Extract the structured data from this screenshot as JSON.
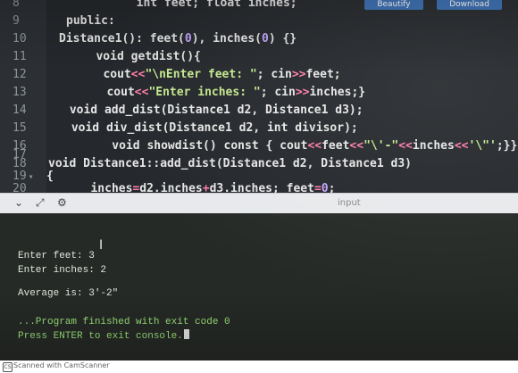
{
  "editor": {
    "top_buttons": [
      "Beautify",
      "Download"
    ],
    "lines": [
      {
        "num": "8",
        "segments": [
          {
            "t": "        int feet; float inches;",
            "c": "kw"
          }
        ]
      },
      {
        "num": "9",
        "segments": [
          {
            "t": "public:",
            "c": "kw"
          }
        ]
      },
      {
        "num": "10",
        "segments": [
          {
            "t": "Distance1(): feet(",
            "c": "kw"
          },
          {
            "t": "0",
            "c": "num"
          },
          {
            "t": "), inches(",
            "c": "kw"
          },
          {
            "t": "0",
            "c": "num"
          },
          {
            "t": ") {}",
            "c": "kw"
          }
        ]
      },
      {
        "num": "11",
        "segments": [
          {
            "t": "   void getdist(){",
            "c": "kw"
          }
        ]
      },
      {
        "num": "12",
        "segments": [
          {
            "t": "   cout",
            "c": "kw"
          },
          {
            "t": "<<",
            "c": "op"
          },
          {
            "t": "\"\\nEnter feet: \"",
            "c": "str"
          },
          {
            "t": "; cin",
            "c": "kw"
          },
          {
            "t": ">>",
            "c": "op"
          },
          {
            "t": "feet;",
            "c": "kw"
          }
        ]
      },
      {
        "num": "13",
        "segments": [
          {
            "t": "   cout",
            "c": "kw"
          },
          {
            "t": "<<",
            "c": "op"
          },
          {
            "t": "\"Enter inches: \"",
            "c": "str"
          },
          {
            "t": "; cin",
            "c": "kw"
          },
          {
            "t": ">>",
            "c": "op"
          },
          {
            "t": "inches;}",
            "c": "kw"
          }
        ]
      },
      {
        "num": "14",
        "segments": [
          {
            "t": " void add_dist(Distance1 d2, Distance1 d3);",
            "c": "kw"
          }
        ]
      },
      {
        "num": "15",
        "segments": [
          {
            "t": " void div_dist(Distance1 d2, int divisor);",
            "c": "kw"
          }
        ]
      },
      {
        "num": "16",
        "segments": [
          {
            "t": "    void showdist() const { cout",
            "c": "kw"
          },
          {
            "t": "<<",
            "c": "op"
          },
          {
            "t": "feet",
            "c": "kw"
          },
          {
            "t": "<<",
            "c": "op"
          },
          {
            "t": "\"\\'-\"",
            "c": "str"
          },
          {
            "t": "<<",
            "c": "op"
          },
          {
            "t": "inches",
            "c": "kw"
          },
          {
            "t": "<<",
            "c": "op"
          },
          {
            "t": "'\\\"'",
            "c": "str"
          },
          {
            "t": ";}};",
            "c": "kw"
          }
        ]
      },
      {
        "num": "17",
        "segments": [
          {
            "t": "",
            "c": "kw"
          }
        ]
      },
      {
        "num": "18",
        "segments": [
          {
            "t": "void Distance1::add_dist(Distance1 d2, Distance1 d3)",
            "c": "kw"
          }
        ]
      },
      {
        "num": "19",
        "fold": "▾",
        "segments": [
          {
            "t": "{",
            "c": "kw"
          }
        ]
      },
      {
        "num": "20",
        "segments": [
          {
            "t": "   inches",
            "c": "kw"
          },
          {
            "t": "=",
            "c": "op"
          },
          {
            "t": "d2.inches",
            "c": "kw"
          },
          {
            "t": "+",
            "c": "op"
          },
          {
            "t": "d3.inches; feet",
            "c": "kw"
          },
          {
            "t": "=",
            "c": "op"
          },
          {
            "t": "0",
            "c": "num"
          },
          {
            "t": ";",
            "c": "kw"
          }
        ]
      }
    ]
  },
  "splitter": {
    "input_label": "input",
    "tools": [
      "chevron-down-icon",
      "expand-icon",
      "settings-icon"
    ]
  },
  "console": {
    "lines": [
      "Enter feet: 3",
      "Enter inches: 2",
      "",
      "Average is: 3'-2\"",
      "",
      "",
      "...Program finished with exit code 0",
      "Press ENTER to exit console."
    ]
  },
  "footer": {
    "logo": "CS",
    "text": "Scanned with CamScanner"
  },
  "colors": {
    "editor_bg": "#25282c",
    "operator": "#ff7ea8",
    "string": "#c3e88d",
    "number": "#c3a5ff",
    "console_finish": "#9be37a"
  }
}
